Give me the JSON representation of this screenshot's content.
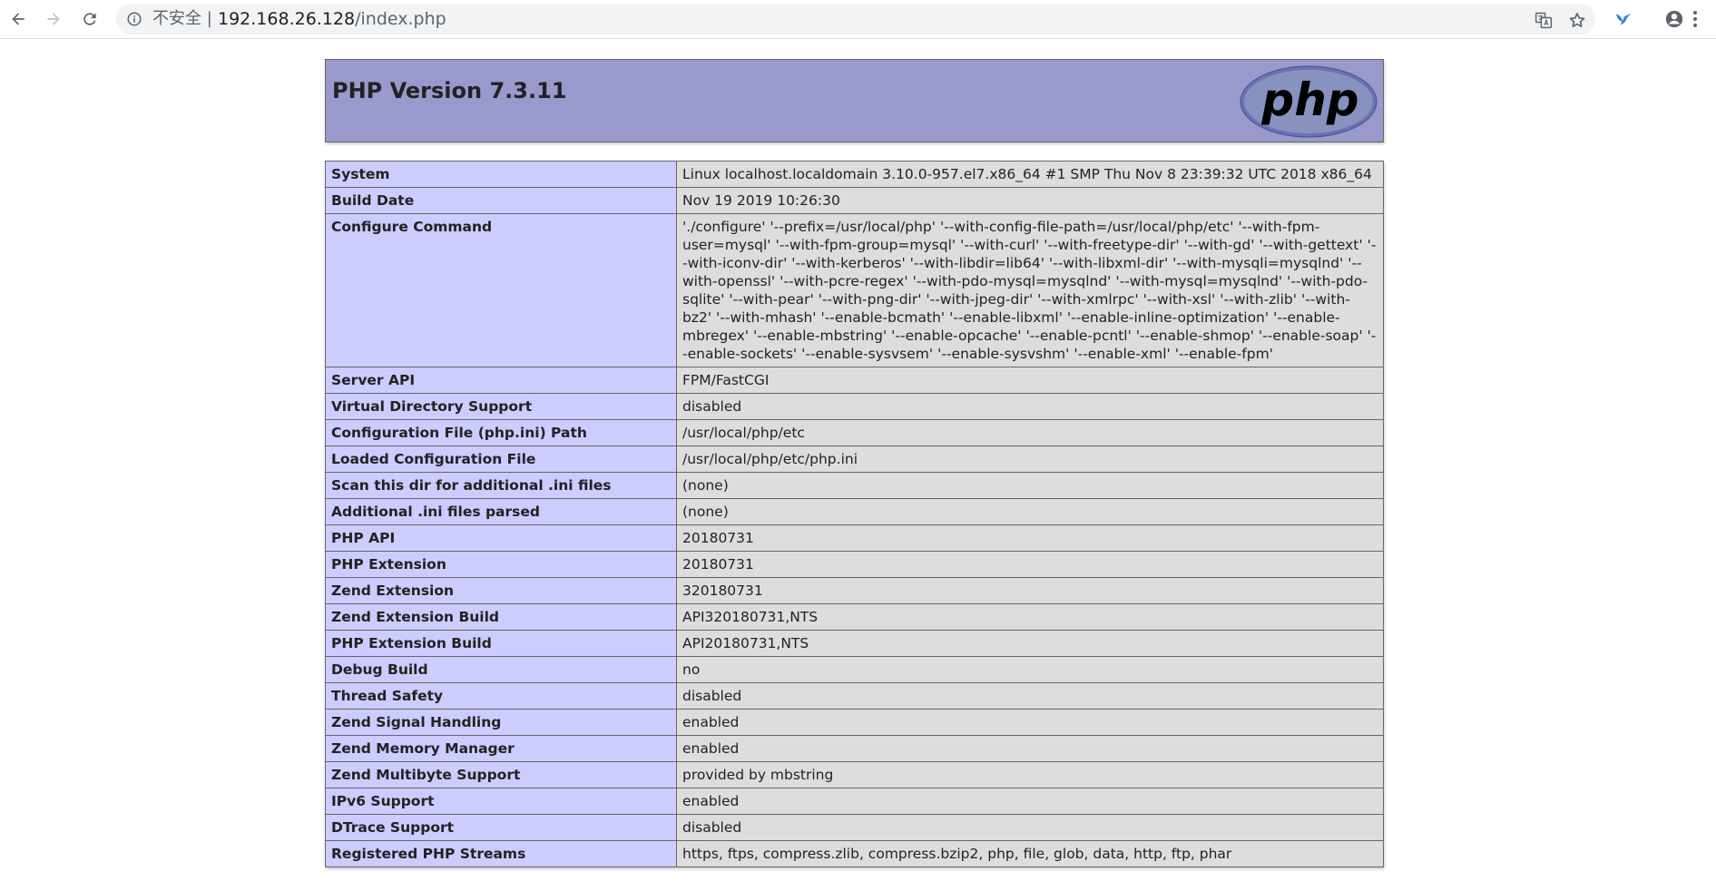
{
  "browser": {
    "security_label": "不安全 |",
    "url_host": "192.168.26.128",
    "url_path": "/index.php"
  },
  "page": {
    "title": "PHP Version 7.3.11",
    "logo_text": "php",
    "rows": [
      {
        "key": "System",
        "value": "Linux localhost.localdomain 3.10.0-957.el7.x86_64 #1 SMP Thu Nov 8 23:39:32 UTC 2018 x86_64"
      },
      {
        "key": "Build Date",
        "value": "Nov 19 2019 10:26:30"
      },
      {
        "key": "Configure Command",
        "value": "'./configure' '--prefix=/usr/local/php' '--with-config-file-path=/usr/local/php/etc' '--with-fpm-user=mysql' '--with-fpm-group=mysql' '--with-curl' '--with-freetype-dir' '--with-gd' '--with-gettext' '--with-iconv-dir' '--with-kerberos' '--with-libdir=lib64' '--with-libxml-dir' '--with-mysqli=mysqlnd' '--with-openssl' '--with-pcre-regex' '--with-pdo-mysql=mysqlnd' '--with-mysql=mysqlnd' '--with-pdo-sqlite' '--with-pear' '--with-png-dir' '--with-jpeg-dir' '--with-xmlrpc' '--with-xsl' '--with-zlib' '--with-bz2' '--with-mhash' '--enable-bcmath' '--enable-libxml' '--enable-inline-optimization' '--enable-mbregex' '--enable-mbstring' '--enable-opcache' '--enable-pcntl' '--enable-shmop' '--enable-soap' '--enable-sockets' '--enable-sysvsem' '--enable-sysvshm' '--enable-xml' '--enable-fpm'"
      },
      {
        "key": "Server API",
        "value": "FPM/FastCGI"
      },
      {
        "key": "Virtual Directory Support",
        "value": "disabled"
      },
      {
        "key": "Configuration File (php.ini) Path",
        "value": "/usr/local/php/etc"
      },
      {
        "key": "Loaded Configuration File",
        "value": "/usr/local/php/etc/php.ini"
      },
      {
        "key": "Scan this dir for additional .ini files",
        "value": "(none)"
      },
      {
        "key": "Additional .ini files parsed",
        "value": "(none)"
      },
      {
        "key": "PHP API",
        "value": "20180731"
      },
      {
        "key": "PHP Extension",
        "value": "20180731"
      },
      {
        "key": "Zend Extension",
        "value": "320180731"
      },
      {
        "key": "Zend Extension Build",
        "value": "API320180731,NTS"
      },
      {
        "key": "PHP Extension Build",
        "value": "API20180731,NTS"
      },
      {
        "key": "Debug Build",
        "value": "no"
      },
      {
        "key": "Thread Safety",
        "value": "disabled"
      },
      {
        "key": "Zend Signal Handling",
        "value": "enabled"
      },
      {
        "key": "Zend Memory Manager",
        "value": "enabled"
      },
      {
        "key": "Zend Multibyte Support",
        "value": "provided by mbstring"
      },
      {
        "key": "IPv6 Support",
        "value": "enabled"
      },
      {
        "key": "DTrace Support",
        "value": "disabled"
      },
      {
        "key": "Registered PHP Streams",
        "value": "https, ftps, compress.zlib, compress.bzip2, php, file, glob, data, http, ftp, phar"
      }
    ]
  },
  "colors": {
    "header_bg": "#9999cc",
    "key_bg": "#ccccff",
    "value_bg": "#dddddd",
    "border": "#666666"
  }
}
